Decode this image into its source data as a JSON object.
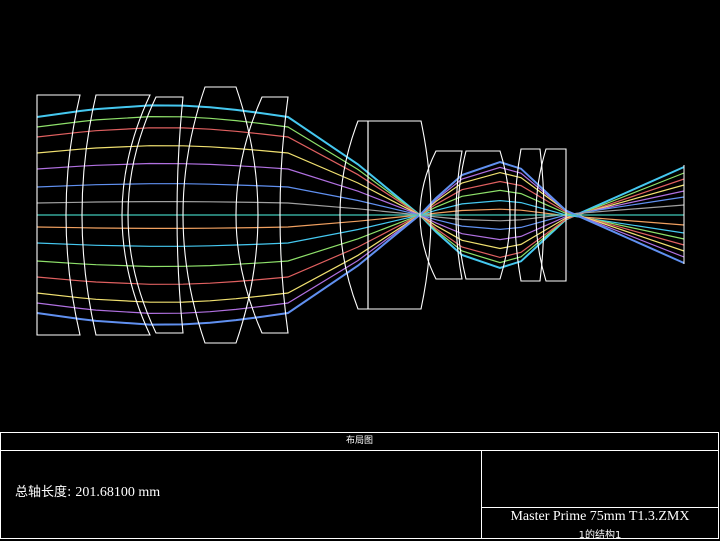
{
  "layout": {
    "lens_groups": 11,
    "ray_colors": [
      "#45c8f0",
      "#8ee06a",
      "#e06060",
      "#f0e070",
      "#b070e0",
      "#6090f0",
      "#a0a0a0",
      "#40c8b8",
      "#f0a060"
    ],
    "lens_color": "#ffffff"
  },
  "panel": {
    "header": "布局图",
    "axis_length_label": "总轴长度:",
    "axis_length_value": "201.68100 mm",
    "file_name": "Master Prime 75mm T1.3.ZMX",
    "config_name": "1的结构1"
  }
}
